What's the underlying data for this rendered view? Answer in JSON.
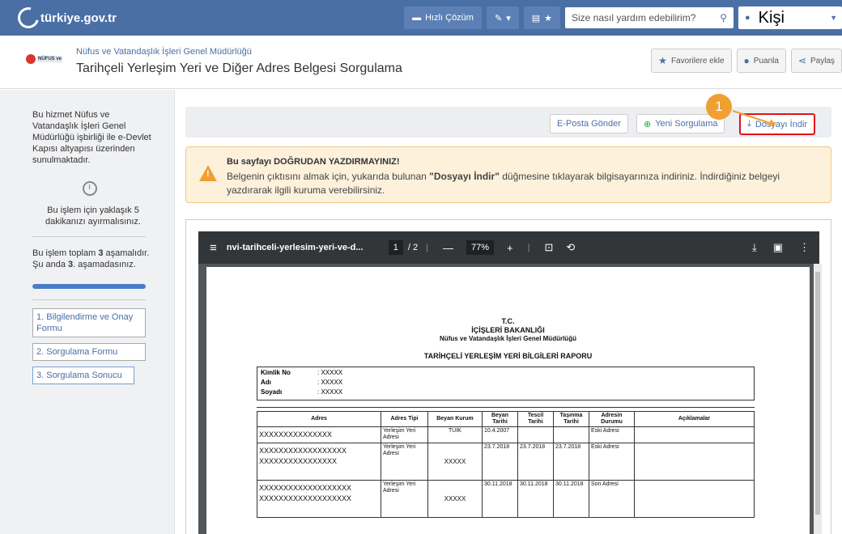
{
  "header": {
    "logo_text": "türkiye.gov.tr",
    "quick_solution": "Hızlı Çözüm",
    "search_placeholder": "Size nasıl yardım edebilirim?",
    "user_label": "Kişi"
  },
  "title_bar": {
    "org_logo_text": "NÜFUS ve",
    "subtitle": "Nüfus ve Vatandaşlık İşleri Genel Müdürlüğü",
    "title": "Tarihçeli Yerleşim Yeri ve Diğer Adres Belgesi Sorgulama",
    "favorites": "Favorilere ekle",
    "rate": "Puanla",
    "share": "Paylaş"
  },
  "sidebar": {
    "info": "Bu hizmet Nüfus ve Vatandaşlık İşleri Genel Müdürlüğü işbirliği ile e-Devlet Kapısı altyapısı üzerinden sunulmaktadır.",
    "time_note": "Bu işlem için yaklaşık 5 dakikanızı ayırmalısınız.",
    "steps_prefix": "Bu işlem toplam ",
    "steps_total": "3",
    "steps_middle": " aşamalıdır. Şu anda ",
    "steps_current": "3",
    "steps_suffix": ". aşamadasınız.",
    "progress": 1.0,
    "step_items": [
      "1. Bilgilendirme ve Onay Formu",
      "2. Sorgulama Formu",
      "3. Sorgulama Sonucu"
    ]
  },
  "actions": {
    "email": "E-Posta Gönder",
    "new_query": "Yeni Sorgulama",
    "download": "Dosyayı İndir",
    "marker": "1"
  },
  "warning": {
    "title": "Bu sayfayı DOĞRUDAN YAZDIRMAYINIZ!",
    "body_pre": "Belgenin çıktısını almak için, yukarıda bulunan ",
    "body_bold": "\"Dosyayı İndir\"",
    "body_post": " düğmesine tıklayarak bilgisayarınıza indiriniz. İndirdiğiniz belgeyi yazdırarak ilgili kuruma verebilirsiniz."
  },
  "pdf": {
    "filename": "nvi-tarihceli-yerlesim-yeri-ve-d...",
    "page_current": "1",
    "page_total": "/ 2",
    "zoom": "77%"
  },
  "document": {
    "tc": "T.C.",
    "ministry": "İÇİŞLERİ BAKANLIĞI",
    "org": "Nüfus ve Vatandaşlık İşleri Genel Müdürlüğü",
    "report_title": "TARİHÇELİ YERLEŞİM YERİ BİLGİLERİ RAPORU",
    "identity": [
      {
        "k": "Kimlik No",
        "v": ": XXXXX"
      },
      {
        "k": "Adı",
        "v": ": XXXXX"
      },
      {
        "k": "Soyadı",
        "v": ": XXXXX"
      }
    ],
    "columns": [
      "Adres",
      "Adres Tipi",
      "Beyan Kurum",
      "Beyan Tarihi",
      "Tescil Tarihi",
      "Taşınma Tarihi",
      "Adresin Durumu",
      "Açıklamalar"
    ],
    "rows": [
      {
        "adres": "XXXXXXXXXXXXXXX",
        "tip": "Yerleşim Yeri Adresi",
        "kurum": "TÜİK",
        "beyan": "10.4.2007",
        "tescil": "",
        "tasinma": "",
        "durum": "Eski Adresi",
        "aciklama": ""
      },
      {
        "adres": "XXXXXXXXXXXXXXXXXX XXXXXXXXXXXXXXXX",
        "tip": "Yerleşim Yeri Adresi",
        "kurum": "XXXXX",
        "beyan": "23.7.2018",
        "tescil": "23.7.2018",
        "tasinma": "23.7.2018",
        "durum": "Eski Adresi",
        "aciklama": ""
      },
      {
        "adres": "XXXXXXXXXXXXXXXXXXX XXXXXXXXXXXXXXXXXXX",
        "tip": "Yerleşim Yeri Adresi",
        "kurum": "XXXXX",
        "beyan": "30.11.2018",
        "tescil": "30.11.2018",
        "tasinma": "30.11.2018",
        "durum": "Son Adresi",
        "aciklama": ""
      }
    ]
  }
}
